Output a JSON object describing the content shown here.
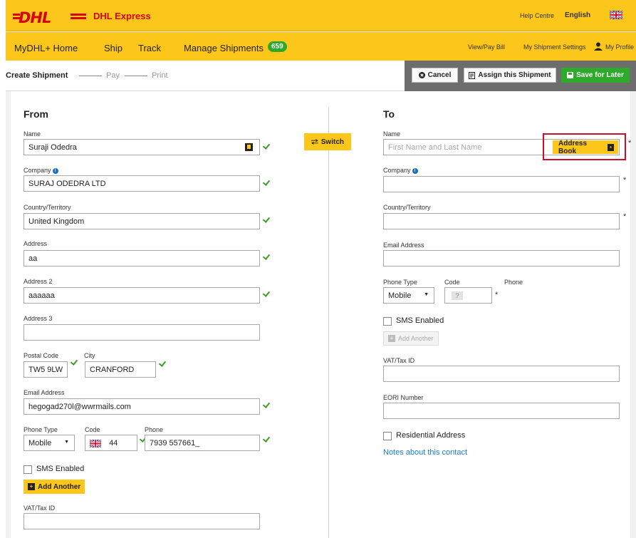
{
  "header": {
    "logo_text": "DHL",
    "brand": "DHL Express",
    "help": "Help Centre",
    "language": "English",
    "flag_icon": "uk-flag-icon"
  },
  "nav": {
    "items": [
      "MyDHL+ Home",
      "Ship",
      "Track",
      "Manage Shipments"
    ],
    "badge": "659",
    "right": [
      "View/Pay Bill",
      "My Shipment Settings",
      "My Profile"
    ]
  },
  "steps": {
    "create": "Create Shipment",
    "pay": "Pay",
    "print": "Print"
  },
  "actions": {
    "cancel": "Cancel",
    "assign": "Assign this Shipment",
    "save": "Save for Later"
  },
  "switch_label": "Switch",
  "from": {
    "title": "From",
    "name_label": "Name",
    "name": "Suraji Odedra",
    "company_label": "Company",
    "company": "SURAJ ODEDRA LTD",
    "country_label": "Country/Territory",
    "country": "United Kingdom",
    "address_label": "Address",
    "address": "aa",
    "address2_label": "Address 2",
    "address2": "aaaaaa",
    "address3_label": "Address 3",
    "address3": "",
    "postal_label": "Postal Code",
    "postal": "TW5 9LW",
    "city_label": "City",
    "city": "CRANFORD",
    "email_label": "Email Address",
    "email": "hegogad270l@wwrmails.com",
    "phone_type_label": "Phone Type",
    "phone_type": "Mobile",
    "code_label": "Code",
    "code": "44",
    "phone_label": "Phone",
    "phone": "7939 557661_",
    "sms_label": "SMS Enabled",
    "add_another": "Add Another",
    "vat_label": "VAT/Tax ID",
    "vat": ""
  },
  "to": {
    "title": "To",
    "name_label": "Name",
    "name_placeholder": "First Name and Last Name",
    "address_book": "Address Book",
    "company_label": "Company",
    "country_label": "Country/Territory",
    "email_label": "Email Address",
    "phone_type_label": "Phone Type",
    "phone_type": "Mobile",
    "code_label": "Code",
    "code_placeholder": "?",
    "phone_label": "Phone",
    "sms_label": "SMS Enabled",
    "add_another": "Add Another",
    "vat_label": "VAT/Tax ID",
    "eori_label": "EORI Number",
    "residential_label": "Residential Address",
    "notes_link": "Notes about this contact"
  },
  "required_mark": "*"
}
